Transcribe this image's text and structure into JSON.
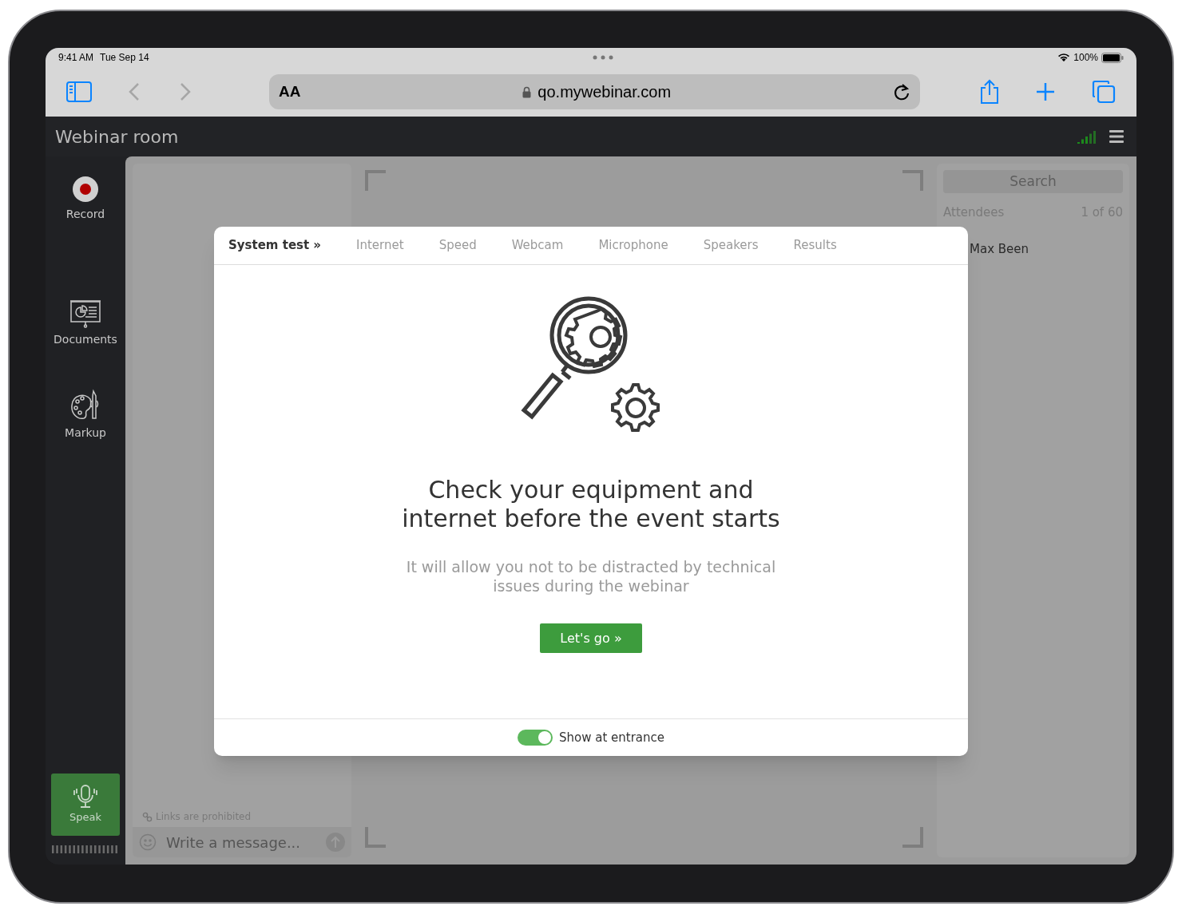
{
  "status_bar": {
    "time": "9:41 AM",
    "date": "Tue Sep 14",
    "battery": "100%"
  },
  "browser": {
    "text_size": "AA",
    "url": "qo.mywebinar.com",
    "back_enabled": false,
    "forward_enabled": false
  },
  "app": {
    "title": "Webinar room"
  },
  "sidebar": {
    "items": [
      {
        "kind": "record",
        "label": "Record"
      },
      {
        "kind": "documents",
        "label": "Documents"
      },
      {
        "kind": "markup",
        "label": "Markup"
      }
    ],
    "speak": "Speak"
  },
  "chat": {
    "notice": "Links are prohibited",
    "placeholder": "Write a message..."
  },
  "attendees": {
    "search": "Search",
    "label": "Attendees",
    "count": "1 of 60",
    "people": [
      "Max Been"
    ]
  },
  "modal": {
    "tabs": [
      {
        "label": "System test »",
        "selected": true
      },
      {
        "label": "Internet",
        "selected": false
      },
      {
        "label": "Speed",
        "selected": false
      },
      {
        "label": "Webcam",
        "selected": false
      },
      {
        "label": "Microphone",
        "selected": false
      },
      {
        "label": "Speakers",
        "selected": false
      },
      {
        "label": "Results",
        "selected": false
      }
    ],
    "heading": [
      "Check your equipment and",
      "internet before the event starts"
    ],
    "description": [
      "It will allow you not to be distracted by technical",
      "issues during the webinar"
    ],
    "button": "Let's go »",
    "show_at_entrance": {
      "label": "Show at entrance",
      "on": true
    }
  }
}
